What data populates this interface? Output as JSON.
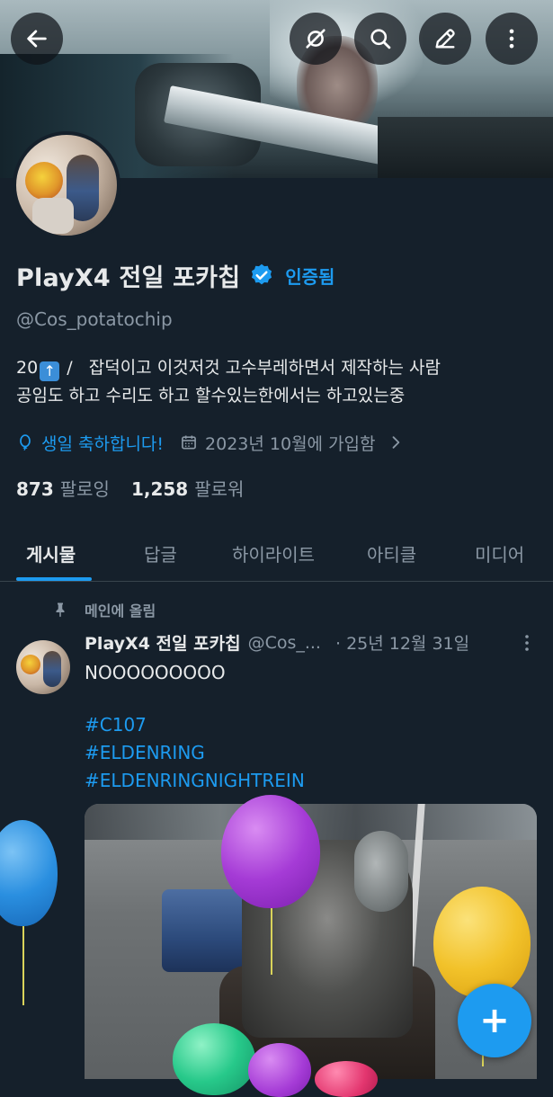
{
  "header": {
    "back_icon": "back-arrow-icon",
    "actions": [
      "grok-icon",
      "search-icon",
      "compose-icon",
      "more-vertical-icon"
    ]
  },
  "profile": {
    "display_name": "PlayX4 전일 포카칩",
    "verified_label": "인증됨",
    "handle": "@Cos_potatochip",
    "bio_prefix": "20",
    "bio_emoji": "⬆️",
    "bio_line1_rest": " /   잡덕이고 이것저것 고수부레하면서 제작하는 사람",
    "bio_line2": "공임도 하고 수리도 하고 할수있는한에서는 하고있는중",
    "birthday_text": "생일 축하합니다!",
    "joined_text": "2023년 10월에 가입함",
    "following_count": "873",
    "following_label": "팔로잉",
    "followers_count": "1,258",
    "followers_label": "팔로워"
  },
  "tabs": [
    "게시물",
    "답글",
    "하이라이트",
    "아티클",
    "미디어"
  ],
  "active_tab": "게시물",
  "pinned_post": {
    "pinned_label": "메인에 올림",
    "author_name": "PlayX4 전일 포카칩",
    "author_handle": "@Cos_...",
    "date": "· 25년 12월 31일",
    "text": "NOOOOOOOOO",
    "hashtags": [
      "#C107",
      "#ELDENRING",
      "#ELDENRINGNIGHTREIN"
    ]
  },
  "fab": {
    "label": "+"
  },
  "colors": {
    "accent": "#1d9bf0",
    "background": "#15202b",
    "muted": "#8b98a5"
  }
}
